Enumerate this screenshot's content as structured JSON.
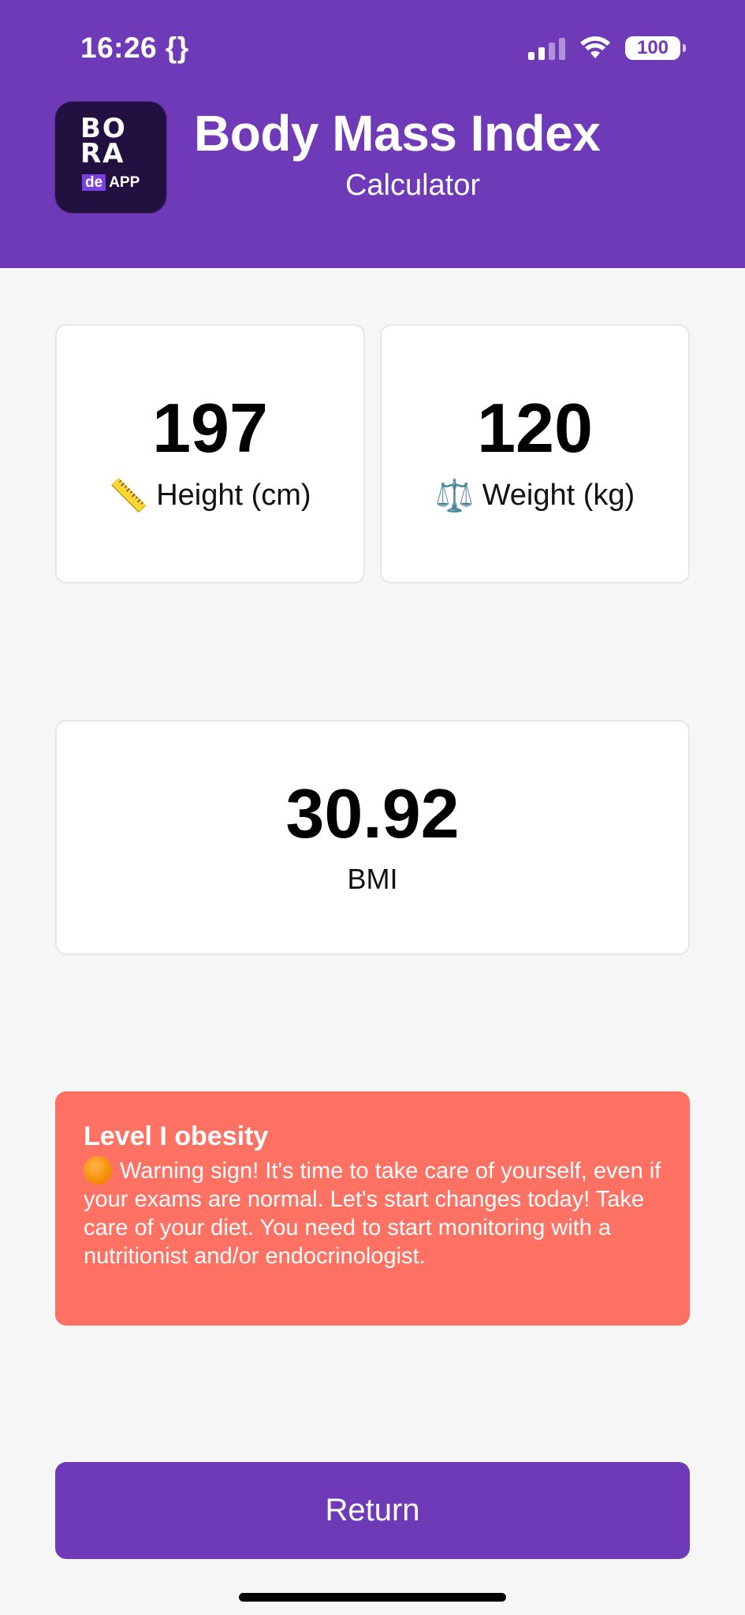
{
  "status_bar": {
    "time": "16:26 {}",
    "battery": "100",
    "icons": [
      "signal-icon",
      "wifi-icon",
      "battery-icon"
    ]
  },
  "header": {
    "logo": {
      "line1": "BO",
      "line2": "RA",
      "sub_de": "de",
      "sub_app": "APP"
    },
    "title": "Body Mass Index",
    "subtitle": "Calculator",
    "background_color": "#6f3ab8"
  },
  "metrics": {
    "height": {
      "value": "197",
      "label": "Height (cm)",
      "icon": "ruler-icon",
      "emoji": "📏"
    },
    "weight": {
      "value": "120",
      "label": "Weight (kg)",
      "icon": "scale-icon",
      "emoji": "⚖️"
    }
  },
  "result": {
    "value": "30.92",
    "label": "BMI"
  },
  "alert": {
    "title": "Level I obesity",
    "icon": "orange-circle-icon",
    "message": "Warning sign! It's time to take care of yourself, even if your exams are normal. Let's start changes today! Take care of your diet. You need to start monitoring with a nutritionist and/or endocrinologist.",
    "background_color": "#ff7163"
  },
  "actions": {
    "return_label": "Return",
    "button_color": "#6f3ab8"
  }
}
